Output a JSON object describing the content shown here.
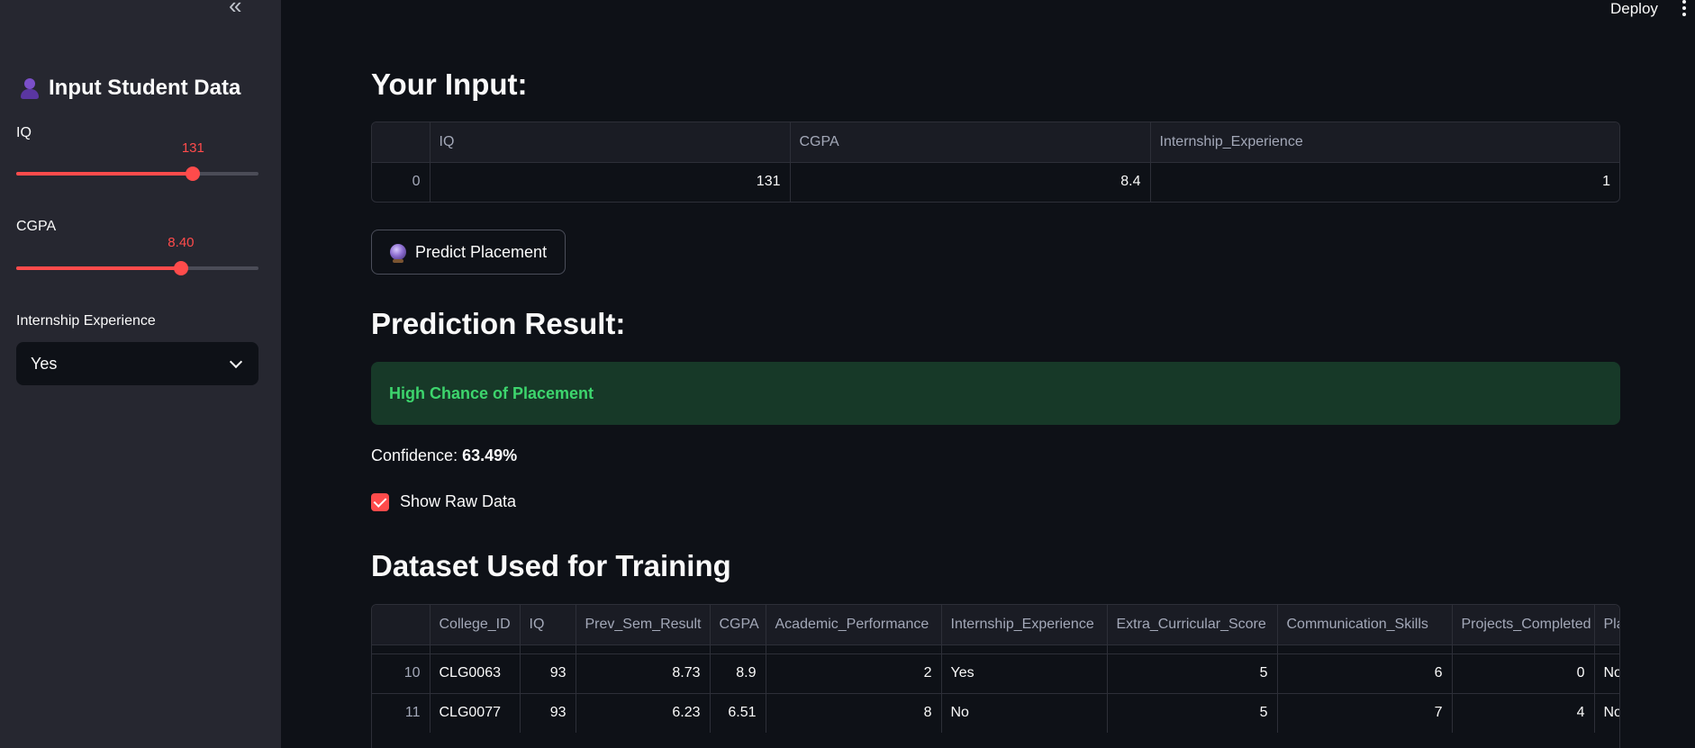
{
  "sidebar": {
    "title": "Input Student Data",
    "iq": {
      "label": "IQ",
      "value_text": "131",
      "fraction": 0.73
    },
    "cgpa": {
      "label": "CGPA",
      "value_text": "8.40",
      "fraction": 0.68
    },
    "internship": {
      "label": "Internship Experience",
      "selected": "Yes"
    }
  },
  "header": {
    "deploy_label": "Deploy"
  },
  "main": {
    "input_heading": "Your Input:",
    "input_table": {
      "columns": [
        "",
        "IQ",
        "CGPA",
        "Internship_Experience"
      ],
      "rows": [
        [
          "0",
          "131",
          "8.4",
          "1"
        ]
      ]
    },
    "predict_label": "Predict Placement",
    "result_heading": "Prediction Result:",
    "result_text": "High Chance of Placement",
    "confidence_label": "Confidence: ",
    "confidence_value": "63.49%",
    "show_raw_label": "Show Raw Data",
    "dataset_heading": "Dataset Used for Training",
    "dataset_table": {
      "columns": [
        "",
        "College_ID",
        "IQ",
        "Prev_Sem_Result",
        "CGPA",
        "Academic_Performance",
        "Internship_Experience",
        "Extra_Curricular_Score",
        "Communication_Skills",
        "Projects_Completed",
        "Pla"
      ],
      "rows": [
        [
          "10",
          "CLG0063",
          "93",
          "8.73",
          "8.9",
          "2",
          "Yes",
          "5",
          "6",
          "0",
          "No"
        ],
        [
          "11",
          "CLG0077",
          "93",
          "6.23",
          "6.51",
          "8",
          "No",
          "5",
          "7",
          "4",
          "No"
        ]
      ]
    }
  },
  "colors": {
    "accent": "#ff4b4b",
    "success_bg": "#173928",
    "success_text": "#3dd56d",
    "sidebar_bg": "#262730",
    "main_bg": "#0e1117"
  }
}
